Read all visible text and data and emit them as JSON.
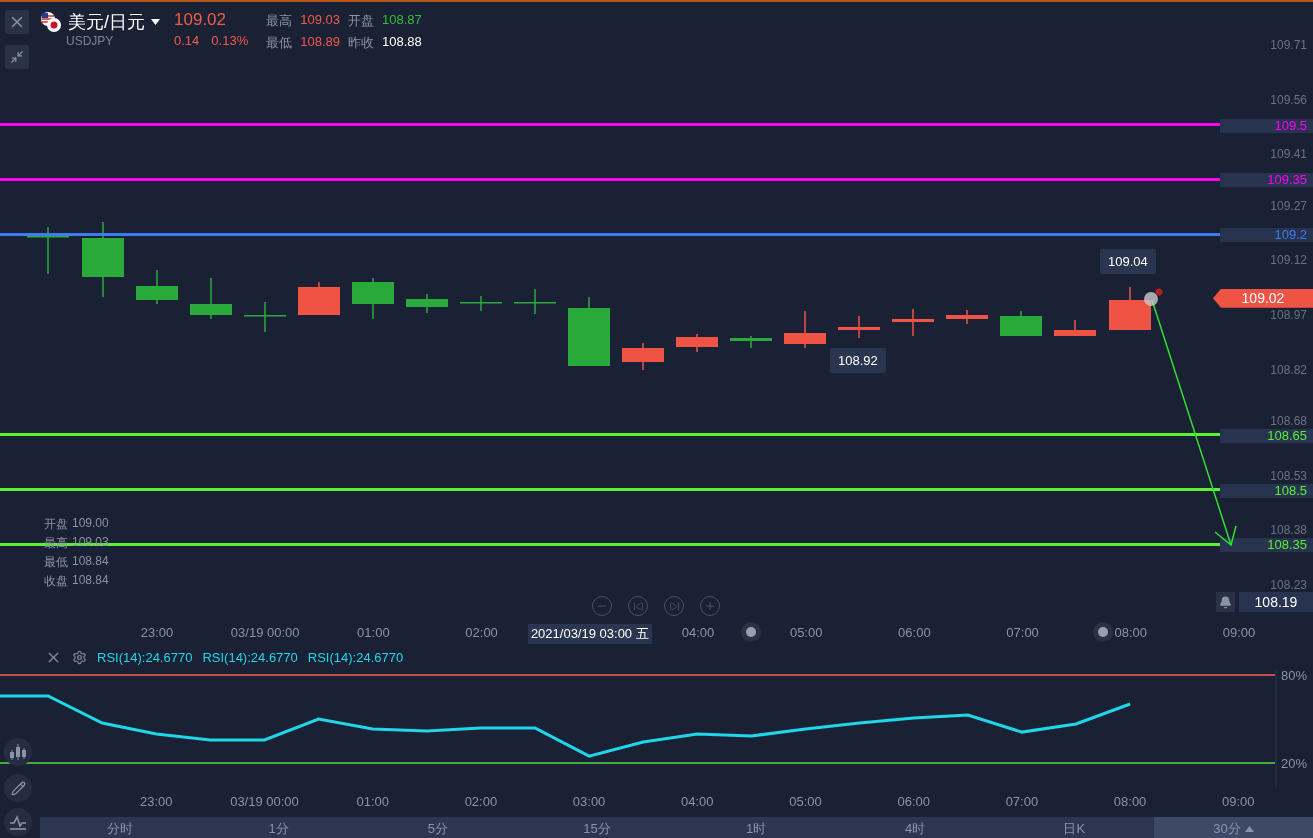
{
  "header": {
    "symbol_name": "美元/日元",
    "symbol_code": "USDJPY",
    "price": "109.02",
    "change": "0.14",
    "change_percent": "0.13%",
    "stats": [
      {
        "label": "最高",
        "value": "109.03",
        "color": "#f05a4a"
      },
      {
        "label": "开盘",
        "value": "108.87",
        "color": "#2bc13a"
      },
      {
        "label": "最低",
        "value": "108.89",
        "color": "#f05a4a"
      },
      {
        "label": "昨收",
        "value": "108.88",
        "color": "#ffffff"
      }
    ]
  },
  "price_axis": [
    "109.71",
    "109.56",
    "109.41",
    "109.27",
    "109.12",
    "108.97",
    "108.82",
    "108.68",
    "108.53",
    "108.38",
    "108.23"
  ],
  "price_lines": [
    {
      "price": "109.5",
      "color": "#ff00ff"
    },
    {
      "price": "109.35",
      "color": "#ff00ff"
    },
    {
      "price": "109.2",
      "color": "#3b7cf0"
    },
    {
      "price": "108.65",
      "color": "#5cf032"
    },
    {
      "price": "108.5",
      "color": "#5cf032"
    },
    {
      "price": "108.35",
      "color": "#5cf032"
    }
  ],
  "callouts": [
    {
      "text": "109.04",
      "kind": "above"
    },
    {
      "text": "108.92",
      "kind": "below"
    }
  ],
  "current_price": "109.02",
  "alert_price": "108.19",
  "ohlc_info": [
    {
      "label": "开盘",
      "value": "109.00"
    },
    {
      "label": "最高",
      "value": "109.03"
    },
    {
      "label": "最低",
      "value": "108.84"
    },
    {
      "label": "收盘",
      "value": "108.84"
    }
  ],
  "time_axis": [
    {
      "label": "23:00",
      "selected": false
    },
    {
      "label": "03/19 00:00",
      "selected": false
    },
    {
      "label": "01:00",
      "selected": false
    },
    {
      "label": "02:00",
      "selected": false
    },
    {
      "label": "2021/03/19 03:00 五",
      "selected": true
    },
    {
      "label": "04:00",
      "selected": false
    },
    {
      "label": "05:00",
      "selected": false
    },
    {
      "label": "06:00",
      "selected": false
    },
    {
      "label": "07:00",
      "selected": false
    },
    {
      "label": "08:00",
      "selected": false
    },
    {
      "label": "09:00",
      "selected": false
    }
  ],
  "rsi": {
    "readings": [
      "RSI(14):24.6770",
      "RSI(14):24.6770",
      "RSI(14):24.6770"
    ],
    "chart_data": {
      "type": "line",
      "categories": [
        null,
        null,
        null,
        "23:00",
        null,
        "03/19 00:00",
        null,
        "01:00",
        null,
        "02:00",
        null,
        "03:00",
        null,
        "04:00",
        null,
        "05:00",
        null,
        "06:00",
        null,
        "07:00",
        null,
        "08:00",
        null,
        "09:00"
      ],
      "series": [
        {
          "color": "#1fd6ea",
          "values": [
            65.7,
            65.7,
            47.3,
            39.8,
            35.7,
            35.7,
            50.0,
            43.2,
            41.8,
            43.9,
            43.9,
            24.7,
            34.3,
            39.8,
            38.4,
            43.2,
            47.3,
            50.7,
            52.7,
            41.1,
            46.6,
            60.2,
            null,
            null
          ]
        }
      ],
      "ylim": [
        3.6,
        88.9
      ],
      "yticks": [
        {
          "value": 20,
          "label": "20%"
        },
        {
          "value": 80,
          "label": "80%"
        }
      ]
    }
  },
  "timeframes": [
    {
      "label": "分时",
      "selected": false
    },
    {
      "label": "1分",
      "selected": false
    },
    {
      "label": "5分",
      "selected": false
    },
    {
      "label": "15分",
      "selected": false
    },
    {
      "label": "1时",
      "selected": false
    },
    {
      "label": "4时",
      "selected": false
    },
    {
      "label": "日K",
      "selected": false
    },
    {
      "label": "30分",
      "selected": true
    }
  ]
}
